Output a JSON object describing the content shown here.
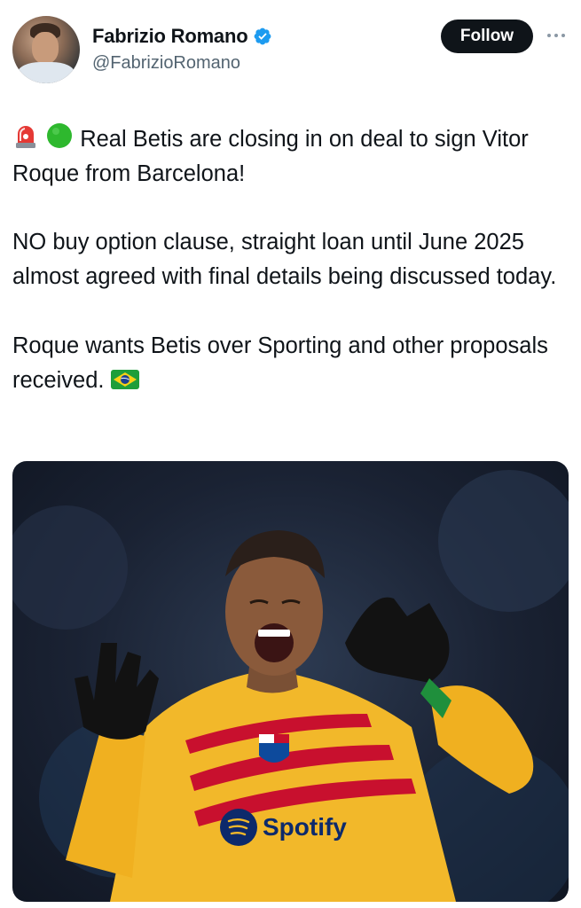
{
  "author": {
    "display_name": "Fabrizio Romano",
    "handle": "@FabrizioRomano",
    "verified": true,
    "avatar_icon": "profile-photo"
  },
  "actions": {
    "follow_label": "Follow",
    "more_icon": "ellipsis-icon"
  },
  "tweet": {
    "line1": "Real Betis are closing in on deal to sign Vitor Roque from Barcelona!",
    "line2": "NO buy option clause, straight loan until June 2025 almost agreed with final details being discussed today.",
    "line3": "Roque wants Betis over Sporting and other proposals received.",
    "emojis": [
      "rotating-light-icon",
      "green-circle-icon",
      "brazil-flag-icon"
    ]
  },
  "media": {
    "description_icon": "player-celebration-photo",
    "sponsor_text": "Spotify"
  },
  "colors": {
    "follow_bg": "#0f1419",
    "verified_blue": "#1d9bf0",
    "handle_grey": "#536471",
    "jersey_yellow": "#f2b82a",
    "jersey_stripe": "#c8102e"
  }
}
